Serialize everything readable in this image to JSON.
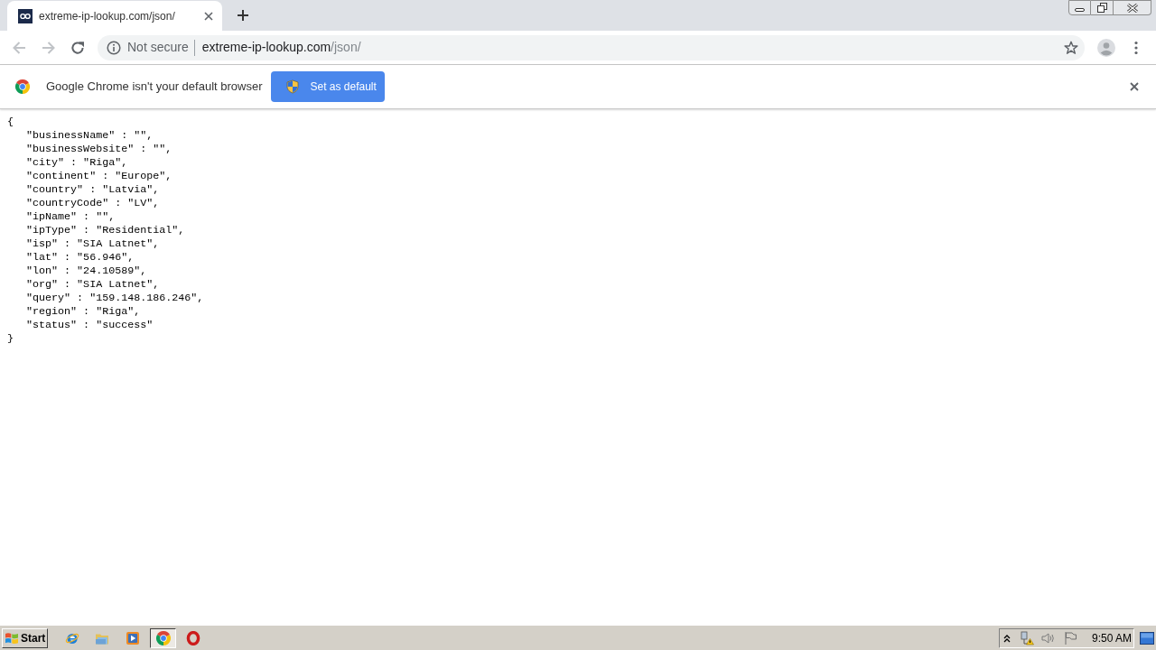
{
  "browser": {
    "tabs": [
      {
        "title": "extreme-ip-lookup.com/json/",
        "selected": true
      }
    ],
    "nav_buttons": [
      {
        "kind": "back",
        "disabled": true
      },
      {
        "kind": "forward",
        "disabled": true
      },
      {
        "kind": "reload",
        "disabled": false
      }
    ],
    "address_bar": {
      "security_label": "Not secure",
      "url_host": "extreme-ip-lookup.com",
      "url_path": "/json/"
    },
    "infobar": {
      "message": "Google Chrome isn't your default browser",
      "button": "Set as default"
    }
  },
  "document": {
    "open": "{",
    "lines": [
      "\"businessName\" : \"\",",
      "\"businessWebsite\" : \"\",",
      "\"city\" : \"Riga\",",
      "\"continent\" : \"Europe\",",
      "\"country\" : \"Latvia\",",
      "\"countryCode\" : \"LV\",",
      "\"ipName\" : \"\",",
      "\"ipType\" : \"Residential\",",
      "\"isp\" : \"SIA Latnet\",",
      "\"lat\" : \"56.946\",",
      "\"lon\" : \"24.10589\",",
      "\"org\" : \"SIA Latnet\",",
      "\"query\" : \"159.148.186.246\",",
      "\"region\" : \"Riga\",",
      "\"status\" : \"success\""
    ],
    "close": "}"
  },
  "taskbar": {
    "start": "Start",
    "apps": [
      {
        "kind": "ie",
        "selected": false
      },
      {
        "kind": "folder",
        "selected": false
      },
      {
        "kind": "media",
        "selected": false
      },
      {
        "kind": "chrome",
        "selected": true
      },
      {
        "kind": "opera",
        "selected": false
      }
    ],
    "clock": "9:50 AM"
  }
}
